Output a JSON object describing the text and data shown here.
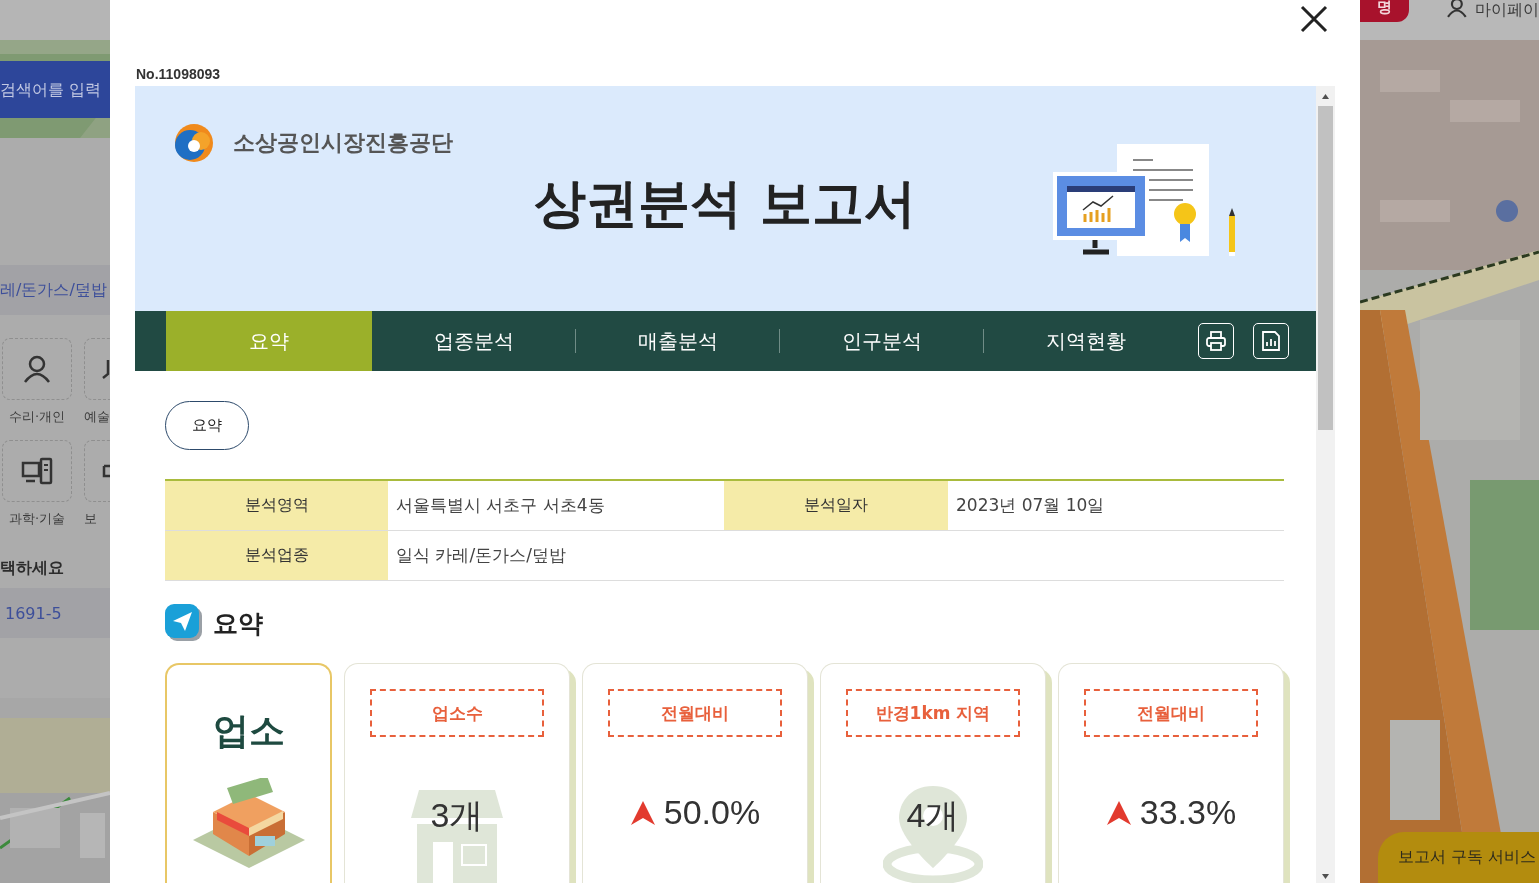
{
  "background": {
    "left_panel": {
      "search_placeholder": "검색어를 입력",
      "category_path": "레/돈가스/덮밥",
      "categories": [
        {
          "label": "수리·개인"
        },
        {
          "label": "예술"
        },
        {
          "label": "과학·기술"
        },
        {
          "label": "보"
        }
      ],
      "prompt": "택하세요",
      "address": "1691-5"
    },
    "top_bar": {
      "help_button": "명",
      "my_page": "마이페이"
    },
    "subscribe_button": "보고서 구독 서비스"
  },
  "modal": {
    "report_no": "No.11098093",
    "org_name": "소상공인시장진흥공단",
    "title": "상권분석 보고서",
    "tabs": [
      {
        "label": "요약",
        "selected": true
      },
      {
        "label": "업종분석",
        "selected": false
      },
      {
        "label": "매출분석",
        "selected": false
      },
      {
        "label": "인구분석",
        "selected": false
      },
      {
        "label": "지역현황",
        "selected": false
      }
    ],
    "section_button": "요약",
    "info": [
      {
        "label": "분석영역",
        "value": "서울특별시 서초구 서초4동"
      },
      {
        "label": "분석일자",
        "value": "2023년 07월 10일"
      },
      {
        "label": "분석업종",
        "value": "일식 카레/돈가스/덮밥"
      }
    ],
    "section_title": "요약",
    "category_card": {
      "title": "업소"
    },
    "stat_cards": [
      {
        "kind": "count",
        "label": "업소수",
        "value": "3개"
      },
      {
        "kind": "change",
        "label": "전월대비",
        "value": "50.0%",
        "rising": true
      },
      {
        "kind": "radius",
        "label": "반경1km 지역",
        "value": "4개"
      },
      {
        "kind": "change",
        "label": "전월대비",
        "value": "33.3%",
        "rising": true
      }
    ]
  }
}
